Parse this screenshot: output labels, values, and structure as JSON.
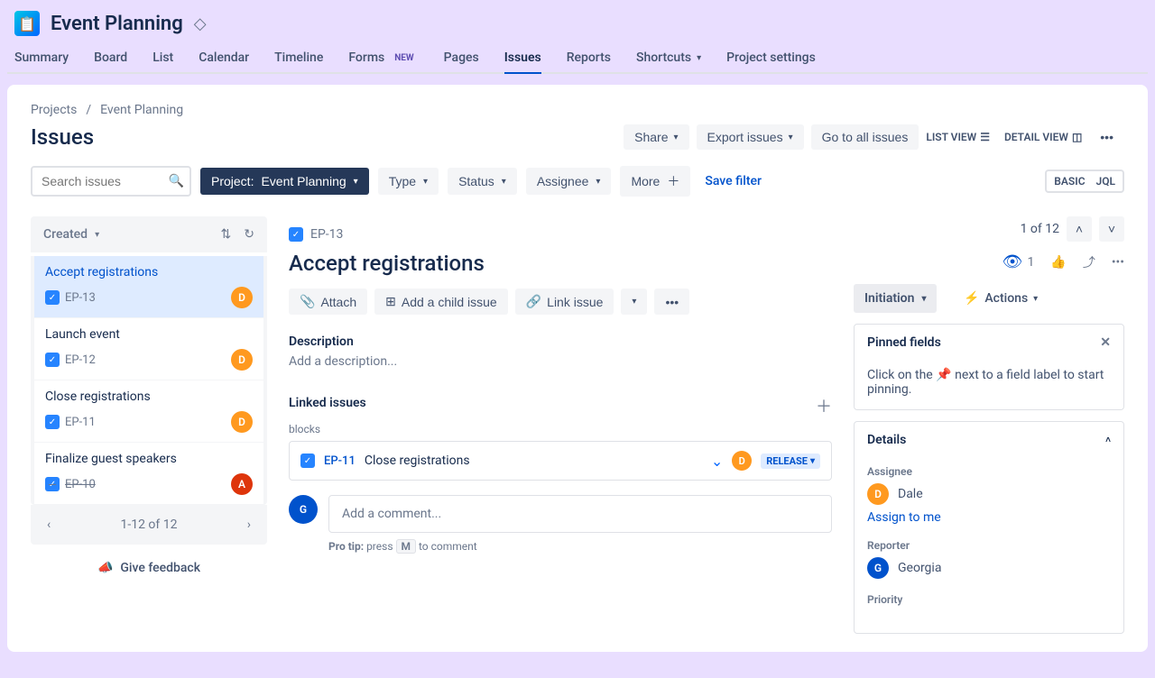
{
  "project": {
    "name": "Event Planning"
  },
  "nav": {
    "tabs": [
      "Summary",
      "Board",
      "List",
      "Calendar",
      "Timeline",
      "Forms",
      "Pages",
      "Issues",
      "Reports",
      "Shortcuts",
      "Project settings"
    ],
    "forms_badge": "NEW",
    "active": "Issues"
  },
  "breadcrumb": {
    "projects": "Projects",
    "project": "Event Planning"
  },
  "page": {
    "title": "Issues"
  },
  "head_actions": {
    "share": "Share",
    "export": "Export issues",
    "goto": "Go to all issues",
    "list_view": "LIST VIEW",
    "detail_view": "DETAIL VIEW"
  },
  "filters": {
    "search_placeholder": "Search issues",
    "project": {
      "label": "Project:",
      "value": "Event Planning"
    },
    "type": "Type",
    "status": "Status",
    "assignee": "Assignee",
    "more": "More",
    "save": "Save filter",
    "basic": "BASIC",
    "jql": "JQL"
  },
  "list": {
    "sort": "Created",
    "items": [
      {
        "title": "Accept registrations",
        "key": "EP-13",
        "avatar": "D",
        "avatarColor": "orange",
        "selected": true
      },
      {
        "title": "Launch event",
        "key": "EP-12",
        "avatar": "D",
        "avatarColor": "orange"
      },
      {
        "title": "Close registrations",
        "key": "EP-11",
        "avatar": "D",
        "avatarColor": "orange"
      },
      {
        "title": "Finalize guest speakers",
        "key": "EP-10",
        "avatar": "A",
        "avatarColor": "red",
        "strike": true
      }
    ],
    "pager": "1-12 of 12",
    "feedback": "Give feedback"
  },
  "detail": {
    "pager": "1 of 12",
    "key": "EP-13",
    "title": "Accept registrations",
    "actions": {
      "attach": "Attach",
      "add_child": "Add a child issue",
      "link": "Link issue"
    },
    "description_label": "Description",
    "description_placeholder": "Add a description...",
    "linked_label": "Linked issues",
    "blocks_label": "blocks",
    "linked": {
      "key": "EP-11",
      "title": "Close registrations",
      "avatar": "D",
      "status": "RELEASE"
    },
    "comment_placeholder": "Add a comment...",
    "comment_avatar": "G",
    "protip_label": "Pro tip:",
    "protip_press": "press",
    "protip_key": "M",
    "protip_rest": "to comment",
    "watch_count": "1"
  },
  "right": {
    "status": "Initiation",
    "actions": "Actions",
    "pinned": {
      "title": "Pinned fields",
      "text": "Click on the 📌 next to a field label to start pinning."
    },
    "details": {
      "title": "Details",
      "assignee_label": "Assignee",
      "assignee": {
        "initial": "D",
        "name": "Dale"
      },
      "assign_to_me": "Assign to me",
      "reporter_label": "Reporter",
      "reporter": {
        "initial": "G",
        "name": "Georgia"
      },
      "priority_label": "Priority"
    }
  }
}
